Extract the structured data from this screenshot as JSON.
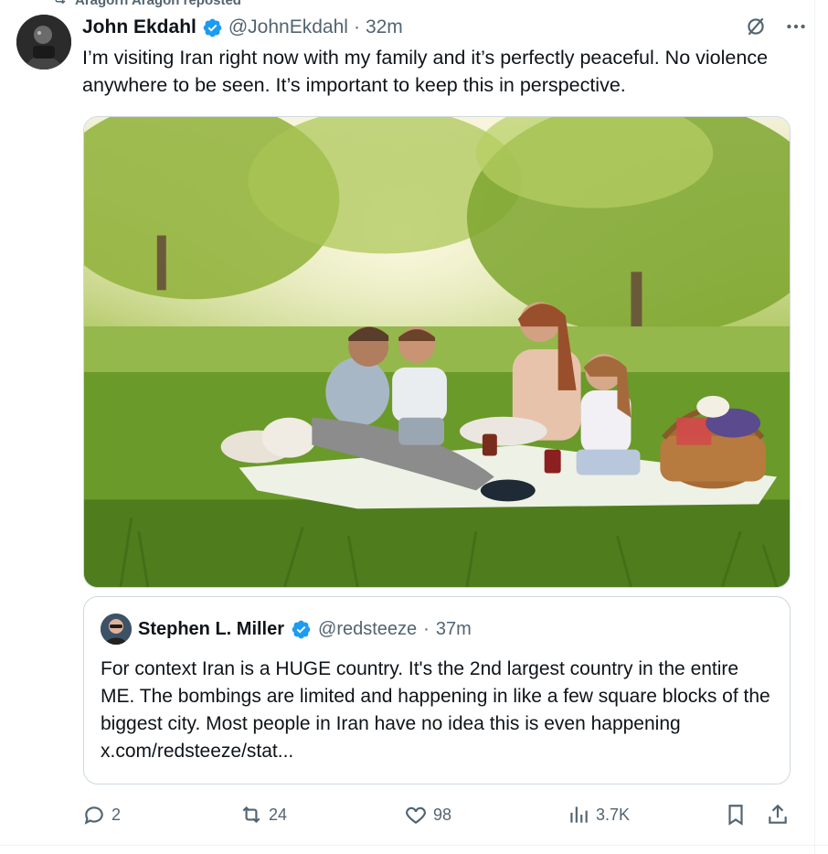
{
  "repost": {
    "text": "Aragorn Aragon reposted",
    "icon": "repost-icon"
  },
  "tweet": {
    "author_name": "John Ekdahl",
    "handle": "@JohnEkdahl",
    "separator": "·",
    "time": "32m",
    "text": "I’m visiting Iran right now with my family and it’s perfectly peaceful. No violence anywhere to be seen. It’s important to keep this in perspective.",
    "verified_icon": "verified-badge-icon",
    "menu_icon": "more-icon",
    "grok_icon": "grok-icon"
  },
  "media": {
    "icon": "photo-family-picnic"
  },
  "quote": {
    "author_name": "Stephen L. Miller",
    "handle": "@redsteeze",
    "separator": "·",
    "time": "37m",
    "text": "For context Iran is a HUGE country.  It's the 2nd largest country in the entire ME. The bombings are limited and happening in like a few square blocks of the biggest city. Most people in Iran have no idea this is even happening x.com/redsteeze/stat..."
  },
  "actions": {
    "replies": "2",
    "reposts": "24",
    "likes": "98",
    "views": "3.7K"
  },
  "colors": {
    "text": "#0f1419",
    "secondary": "#536471",
    "verified": "#1d9bf0",
    "border": "#cfd9de"
  }
}
